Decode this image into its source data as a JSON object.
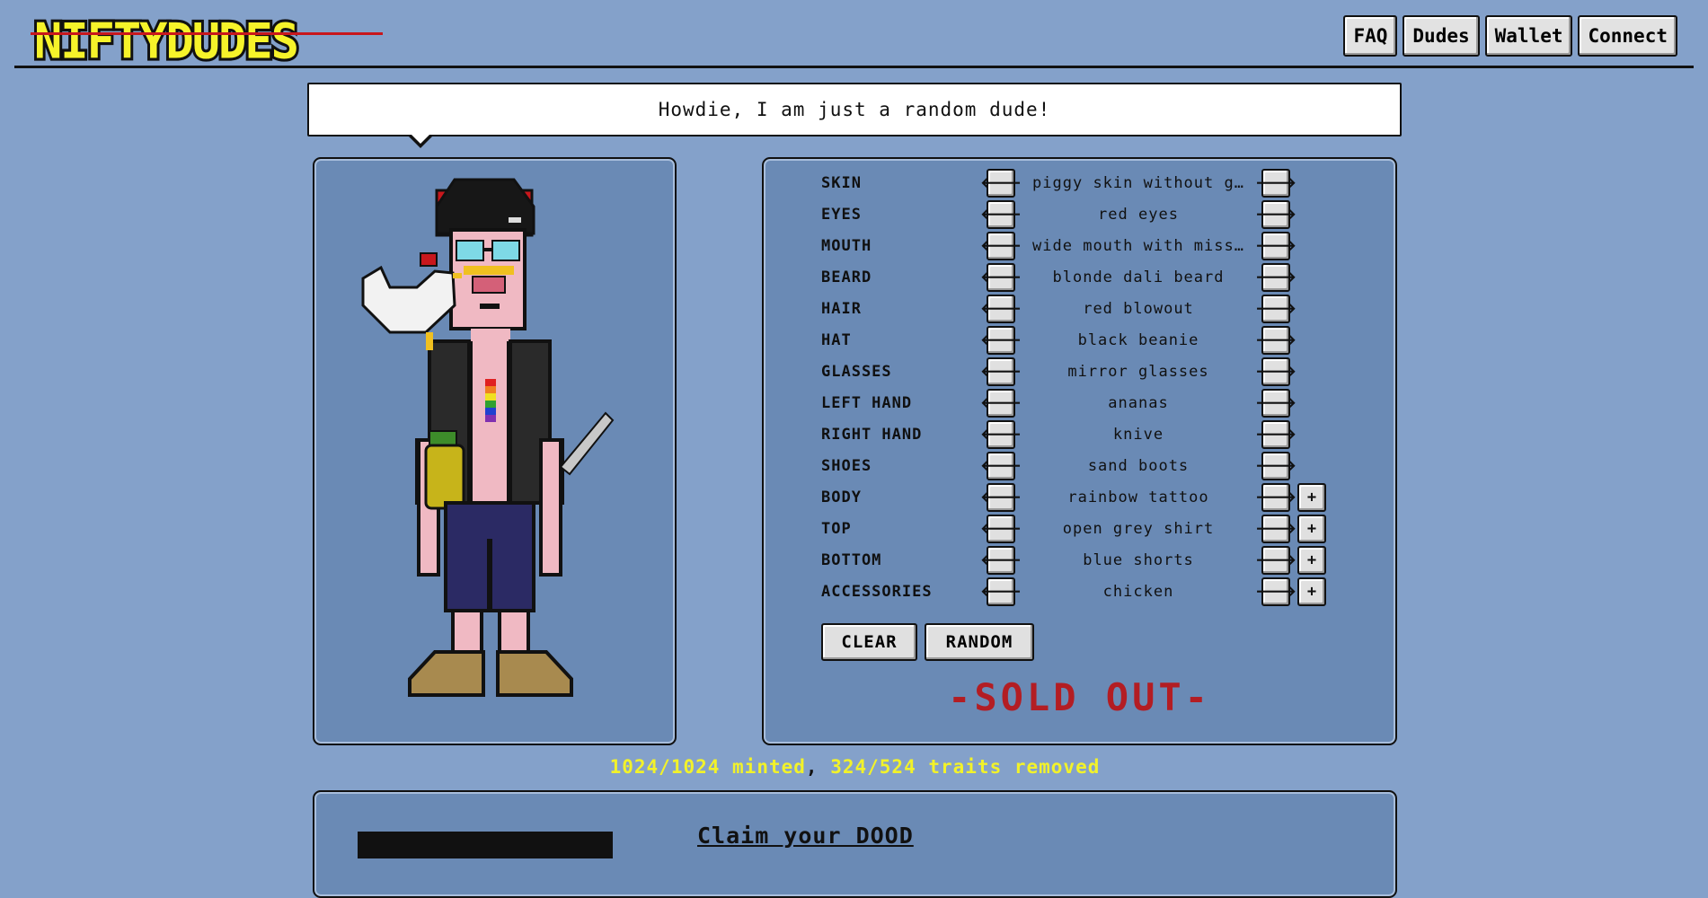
{
  "header": {
    "logo_text": "NIFTYDUDES",
    "nav": [
      "FAQ",
      "Dudes",
      "Wallet",
      "Connect"
    ]
  },
  "speech": {
    "text": "Howdie, I am just a random dude!"
  },
  "traits": [
    {
      "label": "SKIN",
      "value": "piggy skin without g…",
      "plus": false
    },
    {
      "label": "EYES",
      "value": "red eyes",
      "plus": false
    },
    {
      "label": "MOUTH",
      "value": "wide mouth with miss…",
      "plus": false
    },
    {
      "label": "BEARD",
      "value": "blonde dali beard",
      "plus": false
    },
    {
      "label": "HAIR",
      "value": "red blowout",
      "plus": false
    },
    {
      "label": "HAT",
      "value": "black beanie",
      "plus": false
    },
    {
      "label": "GLASSES",
      "value": "mirror glasses",
      "plus": false
    },
    {
      "label": "LEFT HAND",
      "value": "ananas",
      "plus": false
    },
    {
      "label": "RIGHT HAND",
      "value": "knive",
      "plus": false
    },
    {
      "label": "SHOES",
      "value": "sand boots",
      "plus": false
    },
    {
      "label": "BODY",
      "value": "rainbow tattoo",
      "plus": true
    },
    {
      "label": "TOP",
      "value": "open grey shirt",
      "plus": true
    },
    {
      "label": "BOTTOM",
      "value": "blue shorts",
      "plus": true
    },
    {
      "label": "ACCESSORIES",
      "value": "chicken",
      "plus": true
    }
  ],
  "buttons": {
    "prev_glyph": "🡐",
    "next_glyph": "🡒",
    "plus_glyph": "+",
    "clear": "CLEAR",
    "random": "RANDOM"
  },
  "status": {
    "sold_out": "-SOLD OUT-"
  },
  "stats": {
    "minted": "1024/1024 minted",
    "separator": ",",
    "removed": "324/524 traits removed"
  },
  "claim": {
    "title": "Claim your DOOD"
  },
  "colors": {
    "background": "#84a1ca",
    "panel": "#6a8ab5",
    "accent_yellow": "#f2f22a",
    "sold_out_red": "#b31d23"
  }
}
